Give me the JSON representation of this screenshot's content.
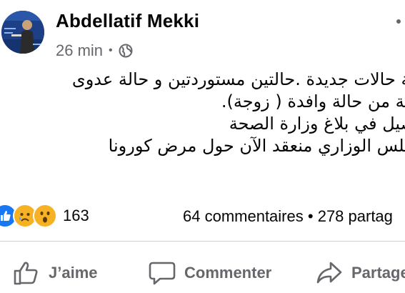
{
  "post": {
    "author": "Abdellatif Mekki",
    "time": "26 min",
    "time_separator": "•",
    "audience_icon": "globe-icon",
    "text_lines": [
      "ثة حالات جديدة .حالتين مستوردتين و حالة عدوى",
      "لية من حالة وافدة ( زوجة).",
      "صيل في بلاغ وزارة الصحة",
      "جلس الوزاري منعقد الآن حول مرض كورونا"
    ]
  },
  "reactions": {
    "icons": [
      "like-icon",
      "sad-icon",
      "wow-icon"
    ],
    "count": "163"
  },
  "stats": {
    "comments": "64 commentaires",
    "separator": "•",
    "shares": "278 partag"
  },
  "actions": {
    "like": "J’aime",
    "comment": "Commenter",
    "share": "Partage"
  },
  "colors": {
    "like_blue": "#1877f2",
    "emoji_yellow": "#f7b125",
    "secondary_text": "#65676b"
  }
}
